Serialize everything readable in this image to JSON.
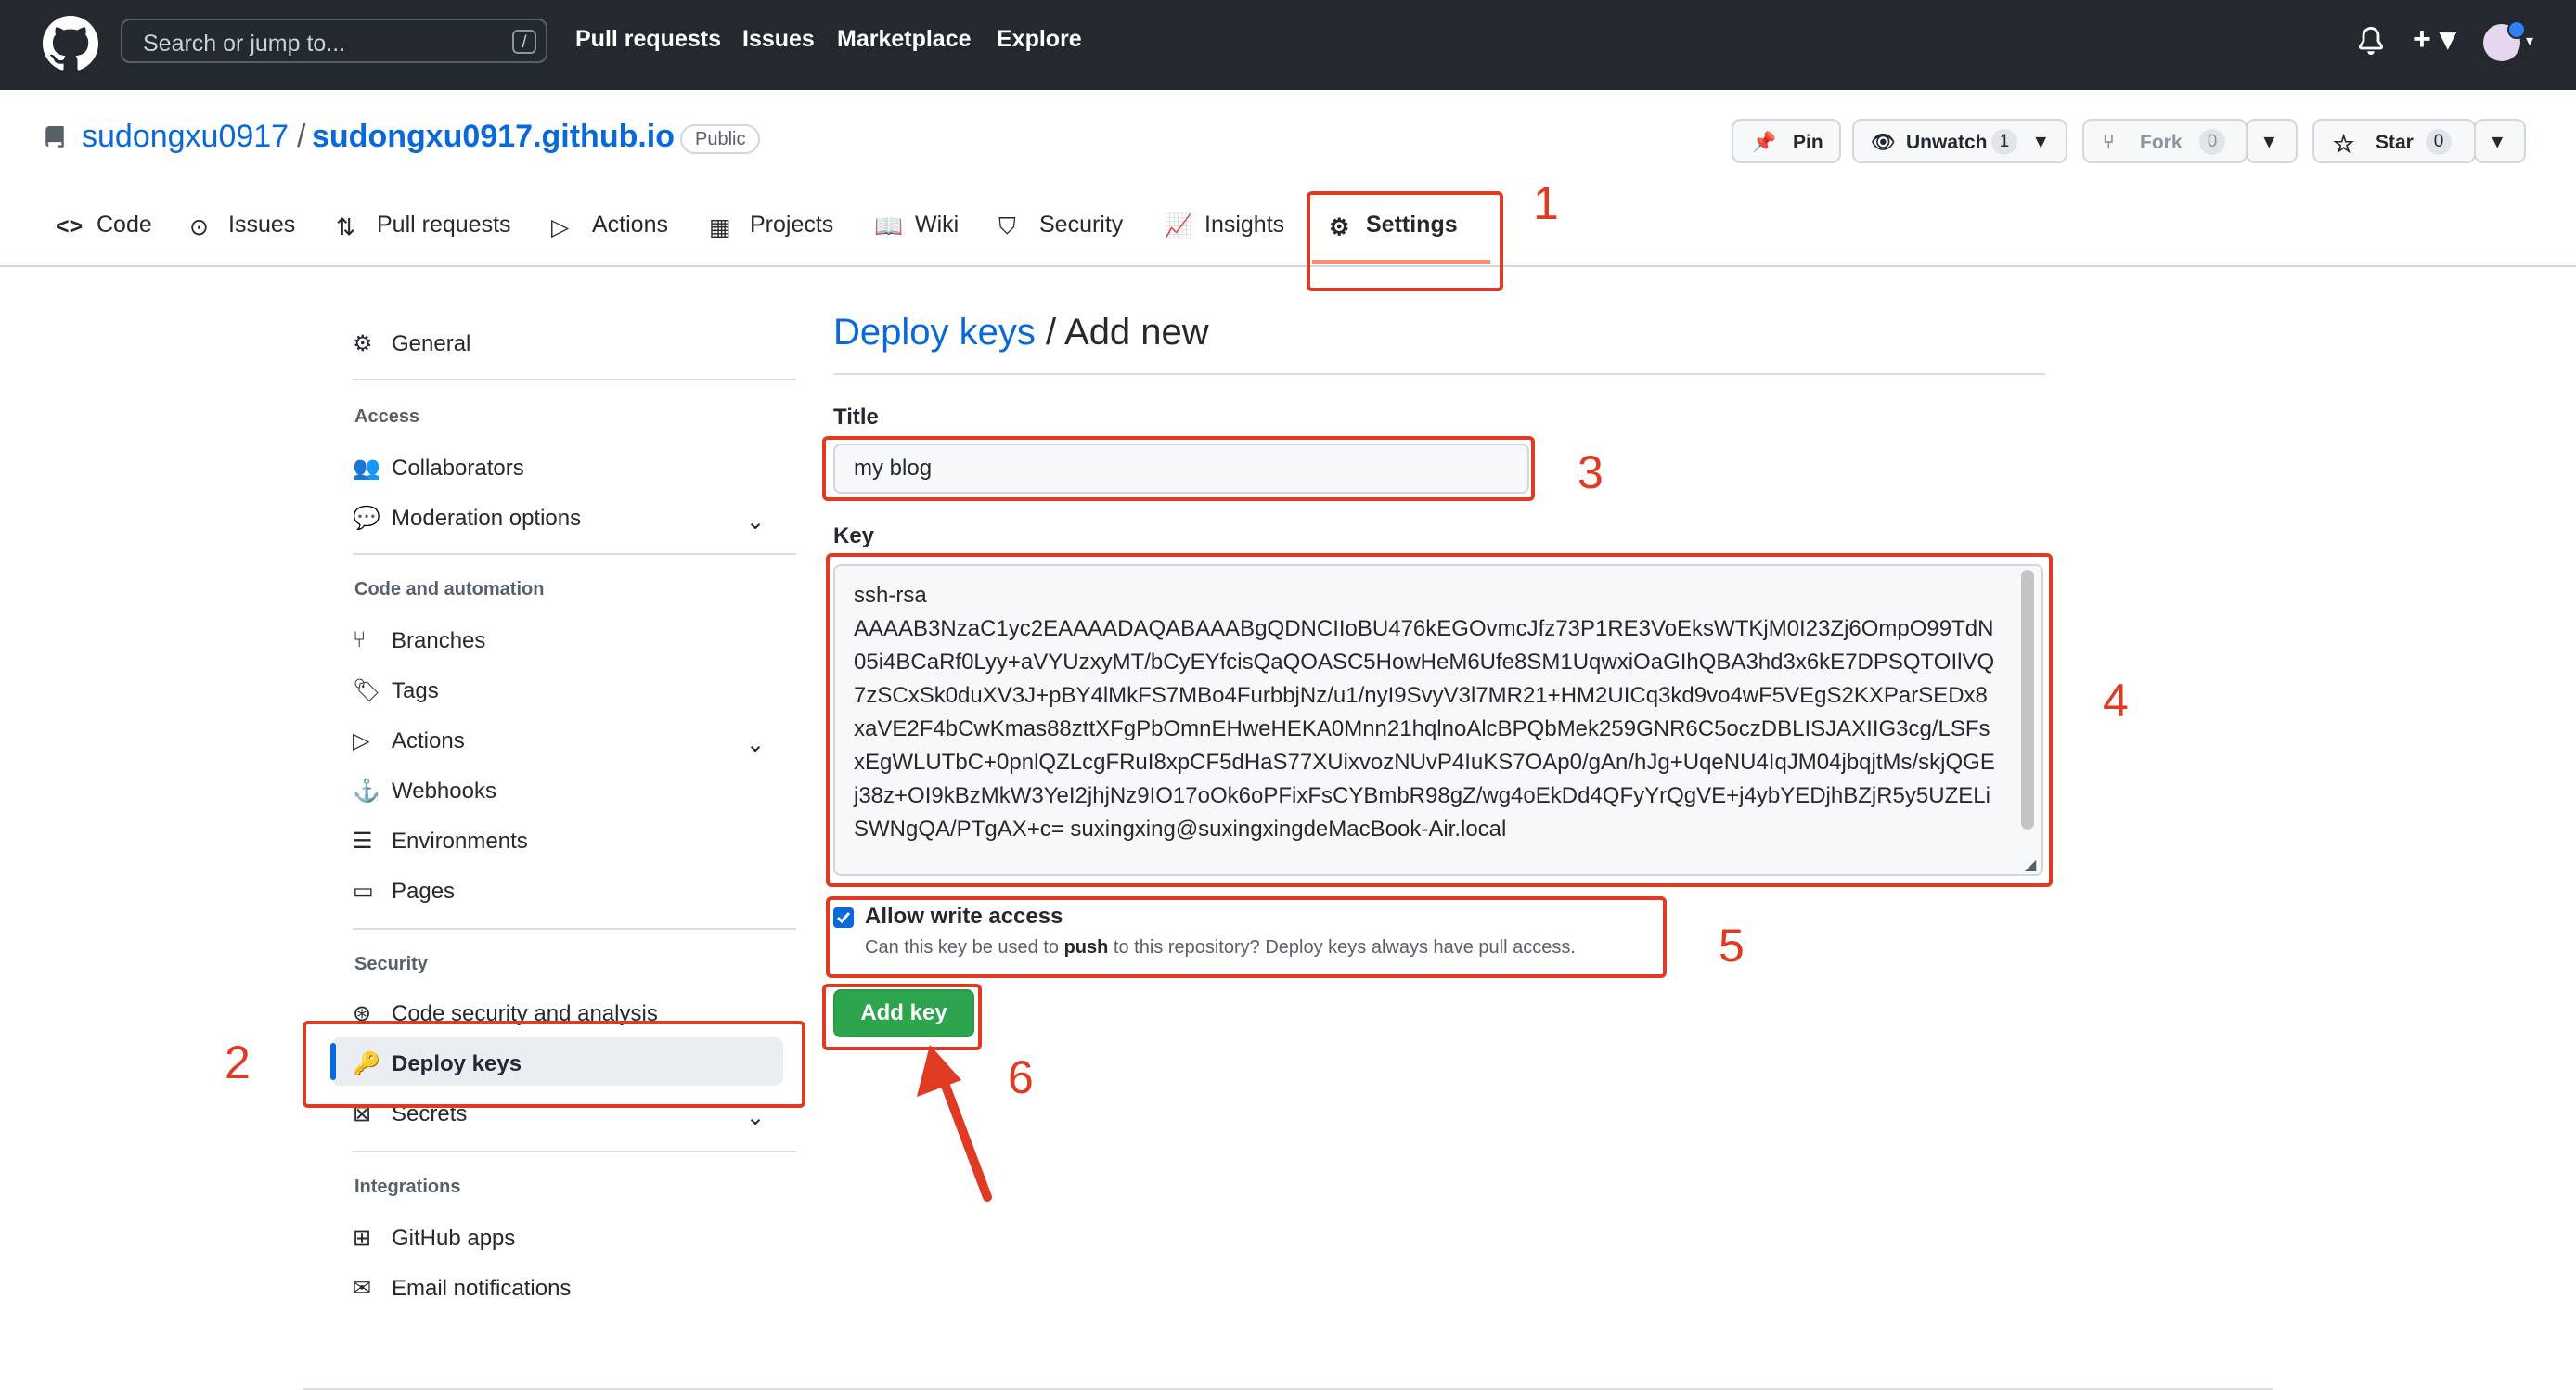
{
  "header": {
    "search_placeholder": "Search or jump to...",
    "search_shortcut": "/",
    "nav": [
      "Pull requests",
      "Issues",
      "Marketplace",
      "Explore"
    ],
    "plus_label": "+ ▾"
  },
  "repo": {
    "owner": "sudongxu0917",
    "separator": "/",
    "name": "sudongxu0917.github.io",
    "visibility": "Public",
    "pin_label": "Pin",
    "unwatch_label": "Unwatch",
    "unwatch_count": "1",
    "fork_label": "Fork",
    "fork_count": "0",
    "star_label": "Star",
    "star_count": "0"
  },
  "tabs": [
    "Code",
    "Issues",
    "Pull requests",
    "Actions",
    "Projects",
    "Wiki",
    "Security",
    "Insights",
    "Settings"
  ],
  "sidebar": {
    "general": "General",
    "access_heading": "Access",
    "collaborators": "Collaborators",
    "moderation": "Moderation options",
    "code_heading": "Code and automation",
    "branches": "Branches",
    "tags": "Tags",
    "actions": "Actions",
    "webhooks": "Webhooks",
    "environments": "Environments",
    "pages": "Pages",
    "security_heading": "Security",
    "code_security": "Code security and analysis",
    "deploy_keys": "Deploy keys",
    "secrets": "Secrets",
    "integrations_heading": "Integrations",
    "github_apps": "GitHub apps",
    "email_notifications": "Email notifications"
  },
  "form": {
    "heading_link": "Deploy keys",
    "heading_rest": " / Add new",
    "title_label": "Title",
    "title_value": "my blog",
    "key_label": "Key",
    "key_value": "ssh-rsa\nAAAAB3NzaC1yc2EAAAADAQABAAABgQDNCIIoBU476kEGOvmcJfz73P1RE3VoEksWTKjM0I23Zj6OmpO99TdN05i4BCaRf0Lyy+aVYUzxyMT/bCyEYfcisQaQOASC5HowHeM6Ufe8SM1UqwxiOaGIhQBA3hd3x6kE7DPSQTOIlVQ7zSCxSk0duXV3J+pBY4lMkFS7MBo4FurbbjNz/u1/nyI9SvyV3l7MR21+HM2UICq3kd9vo4wF5VEgS2KXParSEDx8xaVE2F4bCwKmas88zttXFgPbOmnEHweHEKA0Mnn21hqlnoAlcBPQbMek259GNR6C5oczDBLISJAXIIG3cg/LSFsxEgWLUTbC+0pnlQZLcgFRuI8xpCF5dHaS77XUixvozNUvP4IuKS7OAp0/gAn/hJg+UqeNU4IqJM04jbqjtMs/skjQGEj38z+OI9kBzMkW3YeI2jhjNz9IO17oOk6oPFixFsCYBmbR98gZ/wg4oEkDd4QFyYrQgVE+j4ybYEDjhBZjR5y5UZELiSWNgQA/PTgAX+c= suxingxing@suxingxingdeMacBook-Air.local",
    "allow_write_label": "Allow write access",
    "allow_write_note_pre": "Can this key be used to ",
    "allow_write_note_bold": "push",
    "allow_write_note_post": " to this repository? Deploy keys always have pull access.",
    "allow_write_checked": true,
    "submit_label": "Add key"
  },
  "annotations": [
    "1",
    "2",
    "3",
    "4",
    "5",
    "6"
  ],
  "colors": {
    "header_bg": "#24292f",
    "link": "#0969da",
    "primary_button": "#2da44e",
    "annotation_red": "#e03a22",
    "tab_underline": "#fd8c73"
  }
}
